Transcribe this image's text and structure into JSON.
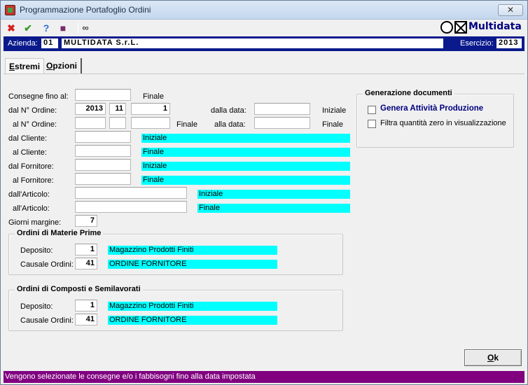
{
  "window": {
    "title": "Programmazione Portafoglio Ordini",
    "close_glyph": "✕"
  },
  "toolbar": {
    "icons": [
      "close-red-icon",
      "confirm-check-icon",
      "help-icon",
      "book-icon",
      "binoculars-icon"
    ],
    "logo_text": "Multidata"
  },
  "company": {
    "azienda_label": "Azienda:",
    "azienda_code": "01",
    "azienda_name": "MULTIDATA S.r.L.",
    "esercizio_label": "Esercizio:",
    "esercizio_value": "2013"
  },
  "tabs": [
    {
      "prefix": "",
      "accel": "E",
      "rest": "stremi",
      "active": true
    },
    {
      "prefix": "",
      "accel": "O",
      "rest": "pzioni",
      "active": false
    }
  ],
  "form": {
    "consegne_label": "Consegne fino al:",
    "consegne_value": "",
    "consegne_tag": "Finale",
    "dal_ordine_label": "dal N° Ordine:",
    "dal_ordine_anno": "2013",
    "dal_ordine_serie": "11",
    "dal_ordine_num": "1",
    "dalla_data_label": "dalla data:",
    "dalla_data_value": "",
    "dalla_data_tag": "Iniziale",
    "al_ordine_label": "al N° Ordine:",
    "al_ordine_anno": "",
    "al_ordine_serie": "",
    "al_ordine_num": "",
    "al_ordine_tag": "Finale",
    "alla_data_label": "alla data:",
    "alla_data_value": "",
    "alla_data_tag": "Finale",
    "dal_cliente_label": "dal Cliente:",
    "dal_cliente_value": "",
    "dal_cliente_desc": "Iniziale",
    "al_cliente_label": "al Cliente:",
    "al_cliente_value": "",
    "al_cliente_desc": "Finale",
    "dal_fornitore_label": "dal Fornitore:",
    "dal_fornitore_value": "",
    "dal_fornitore_desc": "Iniziale",
    "al_fornitore_label": "al Fornitore:",
    "al_fornitore_value": "",
    "al_fornitore_desc": "Finale",
    "dal_articolo_label": "dall'Articolo:",
    "dal_articolo_value": "",
    "dal_articolo_desc": "Iniziale",
    "al_articolo_label": "all'Articolo:",
    "al_articolo_value": "",
    "al_articolo_desc": "Finale",
    "giorni_label": "Giorni margine:",
    "giorni_value": "7"
  },
  "materie_prime": {
    "title": "Ordini di Materie Prime",
    "deposito_label": "Deposito:",
    "deposito_value": "1",
    "deposito_desc": "Magazzino Prodotti Finiti",
    "causale_label": "Causale Ordini:",
    "causale_value": "41",
    "causale_desc": "ORDINE FORNITORE"
  },
  "composti": {
    "title": "Ordini di Composti e Semilavorati",
    "deposito_label": "Deposito:",
    "deposito_value": "1",
    "deposito_desc": "Magazzino Prodotti Finiti",
    "causale_label": "Causale Ordini:",
    "causale_value": "41",
    "causale_desc": "ORDINE FORNITORE"
  },
  "generazione": {
    "title": "Generazione documenti",
    "genera_label": "Genera Attività Produzione",
    "genera_checked": false,
    "filtra_label": "Filtra quantità zero in visualizzazione",
    "filtra_checked": false
  },
  "ok_button": {
    "accel": "O",
    "rest": "k"
  },
  "status": {
    "text": "Vengono selezionate le consegne e/o i fabbisogni fino alla data impostata"
  }
}
